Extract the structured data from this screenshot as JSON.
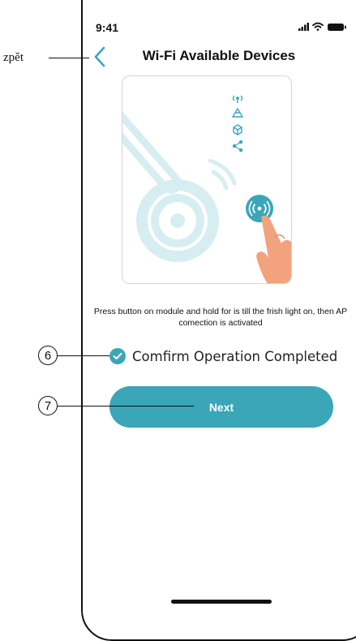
{
  "status_bar": {
    "time": "9:41",
    "icons": [
      "signal-icon",
      "wifi-icon",
      "battery-icon"
    ]
  },
  "header": {
    "title": "Wi-Fi Available Devices",
    "back_icon": "chevron-left-icon"
  },
  "annotations": {
    "back_label": "zpět",
    "confirm_callout": "6",
    "next_callout": "7"
  },
  "illustration": {
    "icons": [
      "antenna-icon",
      "network-icon",
      "cube-icon",
      "share-icon",
      "wifi-pairing-button-icon",
      "pointing-hand-icon",
      "key-icon"
    ]
  },
  "instruction": "Press button on module and hold for is till the frish light on, then AP comection is activated",
  "confirm": {
    "label": "Comfirm Operation Completed",
    "checked": true
  },
  "next_button": {
    "label": "Next"
  },
  "colors": {
    "accent": "#3aa6b8",
    "illustration_light": "#d6eef2",
    "hand": "#f2a27c"
  }
}
